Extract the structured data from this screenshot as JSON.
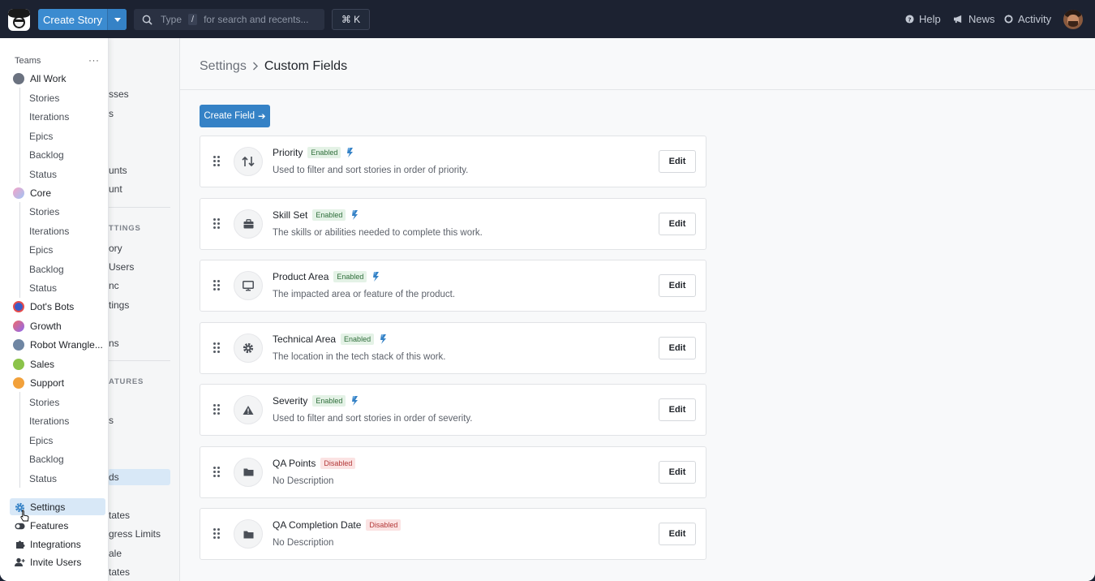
{
  "topbar": {
    "create_story_label": "Create Story",
    "search_type": "Type",
    "search_slash": "/",
    "search_placeholder": "for search and recents...",
    "cmdk_label": "⌘ K",
    "help_label": "Help",
    "news_label": "News",
    "activity_label": "Activity"
  },
  "teams_sidebar": {
    "header": "Teams",
    "more": "···",
    "teams": [
      {
        "label": "All Work",
        "sub": [
          "Stories",
          "Iterations",
          "Epics",
          "Backlog",
          "Status"
        ]
      },
      {
        "label": "Core",
        "sub": [
          "Stories",
          "Iterations",
          "Epics",
          "Backlog",
          "Status"
        ]
      },
      {
        "label": "Dot's Bots"
      },
      {
        "label": "Growth"
      },
      {
        "label": "Robot Wrangle..."
      },
      {
        "label": "Sales"
      },
      {
        "label": "Support",
        "sub": [
          "Stories",
          "Iterations",
          "Epics",
          "Backlog",
          "Status"
        ]
      }
    ],
    "bottom": [
      "Settings",
      "Features",
      "Integrations",
      "Invite Users"
    ]
  },
  "settings_nav_fragments": [
    "sses",
    "s",
    "unts",
    "unt",
    "TTINGS",
    "ory",
    "Users",
    "nc",
    "tings",
    "ns",
    "ATURES",
    "s",
    "ds",
    "tates",
    "gress Limits",
    "ale",
    "tates"
  ],
  "breadcrumb": {
    "parent": "Settings",
    "separator": ">",
    "current": "Custom Fields"
  },
  "create_field_label": "Create Field",
  "create_field_arrow": "➔",
  "fields": [
    {
      "name": "Priority",
      "status": "Enabled",
      "description": "Used to filter and sort stories in order of priority.",
      "icon": "sort-arrows-icon"
    },
    {
      "name": "Skill Set",
      "status": "Enabled",
      "description": "The skills or abilities needed to complete this work.",
      "icon": "briefcase-icon"
    },
    {
      "name": "Product Area",
      "status": "Enabled",
      "description": "The impacted area or feature of the product.",
      "icon": "monitor-icon"
    },
    {
      "name": "Technical Area",
      "status": "Enabled",
      "description": "The location in the tech stack of this work.",
      "icon": "gear-icon"
    },
    {
      "name": "Severity",
      "status": "Enabled",
      "description": "Used to filter and sort stories in order of severity.",
      "icon": "warning-icon"
    },
    {
      "name": "QA Points",
      "status": "Disabled",
      "description": "No Description",
      "icon": "folder-icon"
    },
    {
      "name": "QA Completion Date",
      "status": "Disabled",
      "description": "No Description",
      "icon": "folder-icon"
    }
  ],
  "edit_label": "Edit",
  "colors": {
    "accent": "#3582c6",
    "topbar": "#1c2231",
    "enabled": "#2f6e3b",
    "disabled": "#b33838"
  }
}
